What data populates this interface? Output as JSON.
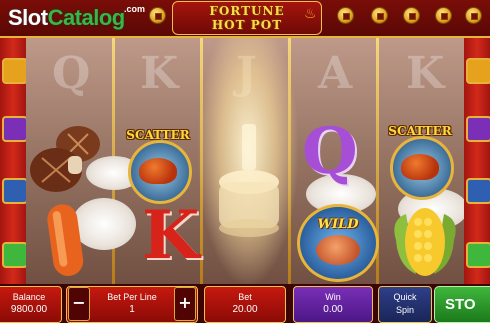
{
  "branding": {
    "logo_slot": "Slot",
    "logo_catalog": "Catalog",
    "logo_com": ".com"
  },
  "game": {
    "title_line1": "FORTUNE",
    "title_line2": "HOT POT"
  },
  "reels": {
    "ghost_letters": [
      "Q",
      "K",
      "J",
      "A",
      "K"
    ],
    "symbols": {
      "scatter_label": "SCATTER",
      "wild_label": "WILD",
      "letter_k": "K",
      "letter_q": "Q"
    }
  },
  "controls": {
    "balance_label": "Balance",
    "balance_value": "9800.00",
    "minus": "−",
    "bet_per_line_label": "Bet Per Line",
    "bet_per_line_value": "1",
    "plus": "+",
    "bet_label": "Bet",
    "bet_value": "20.00",
    "win_label": "Win",
    "win_value": "0.00",
    "quick_spin_line1": "Quick",
    "quick_spin_line2": "Spin",
    "stop_label": "STO"
  },
  "colors": {
    "frame_red": "#7a0d08",
    "gold_trim": "#e7b43c",
    "win_purple": "#7a2fb6",
    "quick_navy": "#2f3f8a",
    "stop_green": "#3fb63c",
    "letter_q_color": "#a64fd6",
    "letter_k_color": "#d8231a"
  },
  "icons": [
    "coin-icon",
    "flame-icon",
    "scatter-icon",
    "wild-icon",
    "mushroom-icon",
    "sausage-icon",
    "corn-icon"
  ]
}
